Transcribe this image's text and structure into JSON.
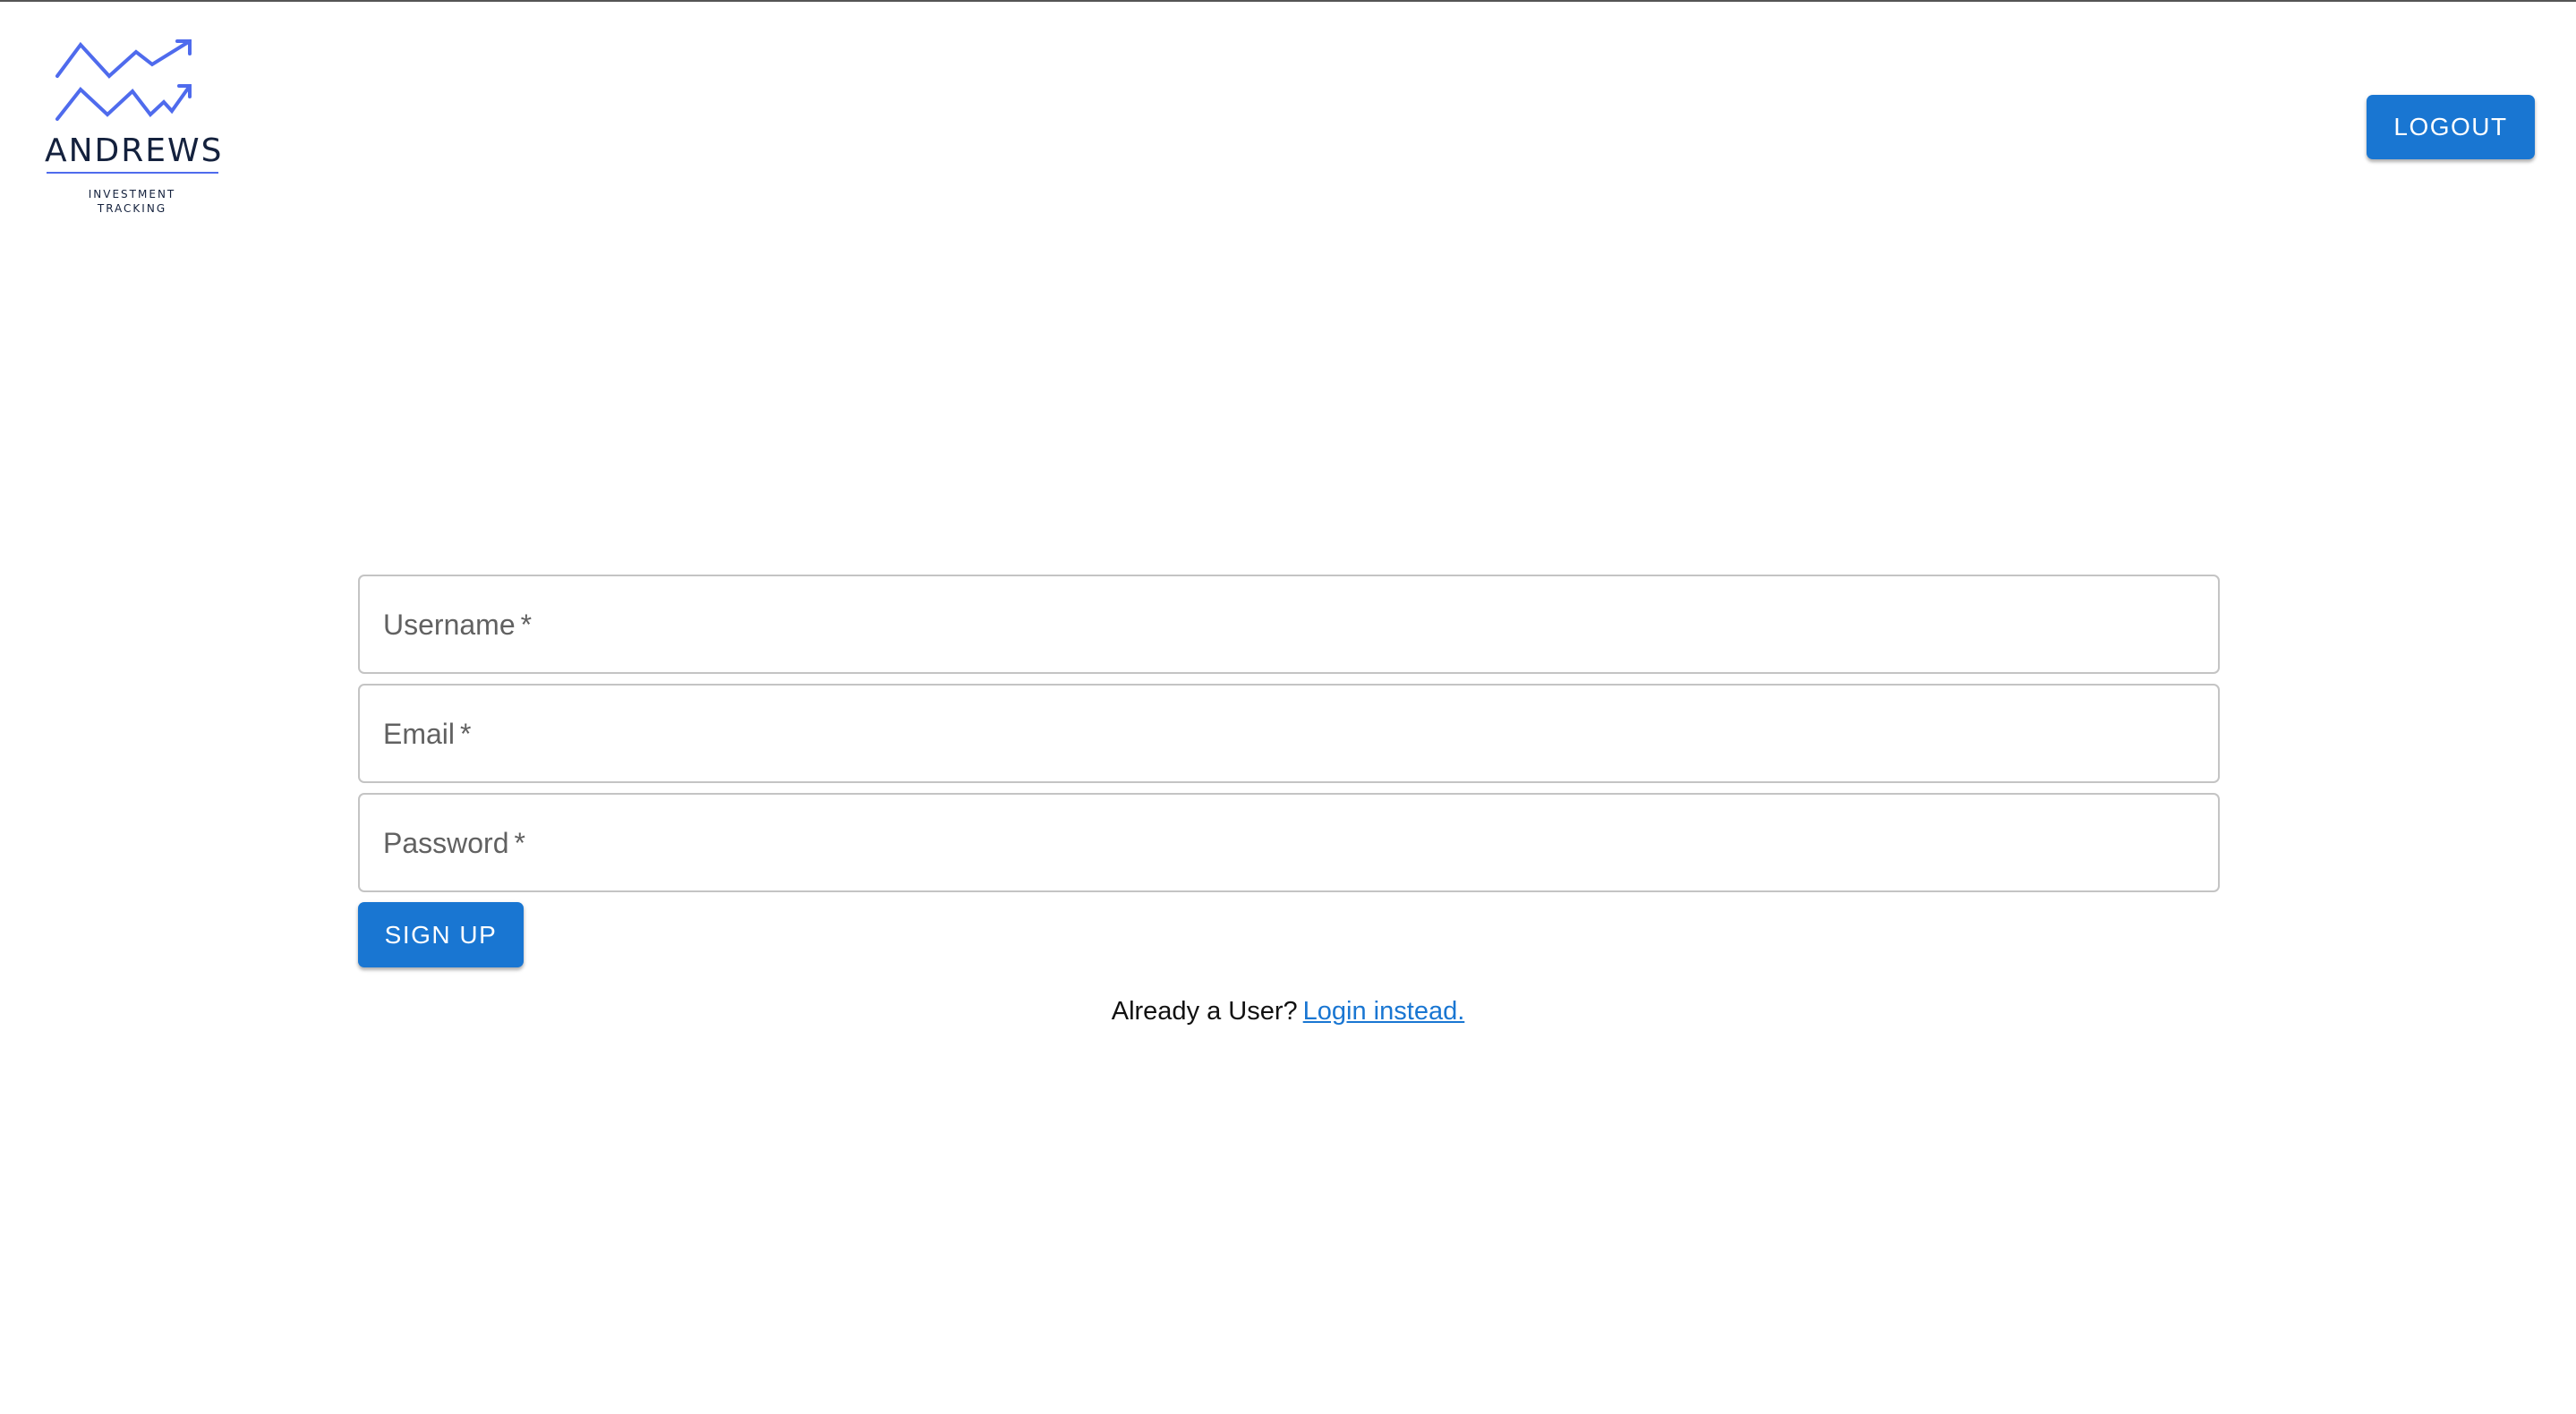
{
  "header": {
    "logo": {
      "icon": "rising-chart-arrows-icon",
      "wordmark": "ANDREWS",
      "tagline_line1": "INVESTMENT",
      "tagline_line2": "TRACKING",
      "brand_color": "#4f6bed"
    },
    "logout_label": "LOGOUT"
  },
  "form": {
    "fields": [
      {
        "label": "Username",
        "required_marker": "*",
        "value": ""
      },
      {
        "label": "Email",
        "required_marker": "*",
        "value": ""
      },
      {
        "label": "Password",
        "required_marker": "*",
        "value": ""
      }
    ],
    "submit_label": "SIGN UP"
  },
  "footer": {
    "prompt_text": "Already a User?",
    "login_link_text": "Login instead."
  },
  "colors": {
    "primary": "#1976d2",
    "field_border": "#c4c4c4",
    "label_text": "#616161"
  }
}
